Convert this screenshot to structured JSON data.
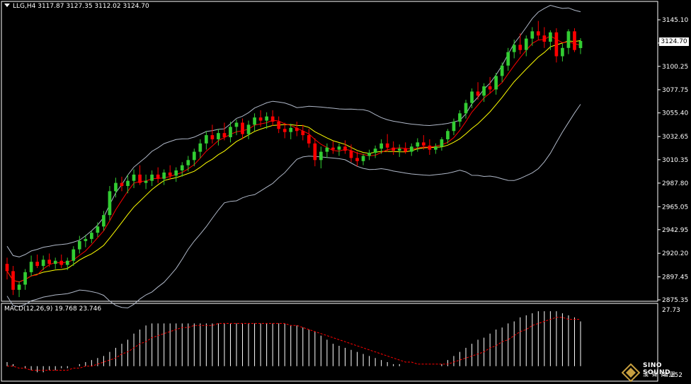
{
  "symbol_header": "LLG,H4",
  "ohlc": {
    "open": "3117.87",
    "high": "3127.35",
    "low": "3112.02",
    "close": "3124.70"
  },
  "current_price": "3124.70",
  "price_axis": [
    "3145.10",
    "3122.70",
    "3100.25",
    "3077.75",
    "3055.40",
    "3032.65",
    "3010.35",
    "2987.80",
    "2965.05",
    "2942.95",
    "2920.20",
    "2897.45",
    "2875.35"
  ],
  "macd": {
    "label": "MACD(12,26,9)",
    "main": "19.768",
    "signal": "23.746",
    "axis_max": "27.73",
    "axis_min": "-4.252"
  },
  "logo": {
    "name": "SINO SOUND",
    "sub": "漢 聲 商 圖"
  },
  "colors": {
    "bull": "#32cd32",
    "bear": "#ff0000",
    "bands": "#b0b8c8",
    "ma_fast": "#ff0000",
    "ma_slow": "#ffff00",
    "macd_bar": "#ffffff",
    "macd_signal": "#ff0000"
  },
  "chart_data": {
    "type": "candlestick",
    "panels": [
      "price",
      "macd"
    ],
    "price_range": [
      2875.35,
      3145.1
    ],
    "candles": [
      [
        2910,
        2916,
        2895,
        2903
      ],
      [
        2903,
        2908,
        2880,
        2885
      ],
      [
        2885,
        2893,
        2878,
        2890
      ],
      [
        2890,
        2905,
        2885,
        2902
      ],
      [
        2902,
        2918,
        2898,
        2912
      ],
      [
        2912,
        2919,
        2906,
        2908
      ],
      [
        2908,
        2918,
        2904,
        2914
      ],
      [
        2914,
        2920,
        2907,
        2910
      ],
      [
        2910,
        2916,
        2905,
        2913
      ],
      [
        2913,
        2919,
        2906,
        2909
      ],
      [
        2909,
        2916,
        2904,
        2913
      ],
      [
        2913,
        2927,
        2908,
        2924
      ],
      [
        2924,
        2937,
        2920,
        2932
      ],
      [
        2932,
        2938,
        2926,
        2934
      ],
      [
        2934,
        2942,
        2930,
        2940
      ],
      [
        2940,
        2950,
        2936,
        2946
      ],
      [
        2946,
        2961,
        2942,
        2957
      ],
      [
        2957,
        2985,
        2952,
        2980
      ],
      [
        2980,
        2993,
        2974,
        2988
      ],
      [
        2988,
        2994,
        2980,
        2985
      ],
      [
        2985,
        2996,
        2978,
        2990
      ],
      [
        2990,
        3001,
        2983,
        2996
      ],
      [
        2996,
        3005,
        2986,
        2988
      ],
      [
        2988,
        2996,
        2982,
        2990
      ],
      [
        2990,
        3000,
        2985,
        2996
      ],
      [
        2996,
        3003,
        2988,
        2992
      ],
      [
        2992,
        3001,
        2986,
        2998
      ],
      [
        2998,
        3005,
        2991,
        2995
      ],
      [
        2995,
        3003,
        2989,
        3000
      ],
      [
        3000,
        3008,
        2994,
        3005
      ],
      [
        3005,
        3014,
        2999,
        3010
      ],
      [
        3010,
        3021,
        3004,
        3018
      ],
      [
        3018,
        3030,
        3012,
        3026
      ],
      [
        3026,
        3038,
        3020,
        3034
      ],
      [
        3034,
        3044,
        3026,
        3030
      ],
      [
        3030,
        3040,
        3024,
        3036
      ],
      [
        3036,
        3046,
        3029,
        3032
      ],
      [
        3032,
        3047,
        3027,
        3042
      ],
      [
        3042,
        3049,
        3034,
        3046
      ],
      [
        3046,
        3050,
        3030,
        3035
      ],
      [
        3035,
        3048,
        3030,
        3044
      ],
      [
        3044,
        3055,
        3038,
        3051
      ],
      [
        3051,
        3058,
        3042,
        3048
      ],
      [
        3048,
        3056,
        3040,
        3052
      ],
      [
        3052,
        3058,
        3043,
        3047
      ],
      [
        3047,
        3052,
        3036,
        3040
      ],
      [
        3040,
        3046,
        3031,
        3037
      ],
      [
        3037,
        3045,
        3030,
        3041
      ],
      [
        3041,
        3047,
        3033,
        3038
      ],
      [
        3038,
        3044,
        3029,
        3034
      ],
      [
        3034,
        3040,
        3022,
        3026
      ],
      [
        3026,
        3031,
        3004,
        3010
      ],
      [
        3010,
        3023,
        3002,
        3018
      ],
      [
        3018,
        3026,
        3012,
        3022
      ],
      [
        3022,
        3028,
        3016,
        3020
      ],
      [
        3020,
        3026,
        3014,
        3023
      ],
      [
        3023,
        3029,
        3016,
        3019
      ],
      [
        3019,
        3025,
        3008,
        3012
      ],
      [
        3012,
        3018,
        3004,
        3009
      ],
      [
        3009,
        3016,
        3005,
        3014
      ],
      [
        3014,
        3020,
        3010,
        3017
      ],
      [
        3017,
        3024,
        3012,
        3021
      ],
      [
        3021,
        3030,
        3016,
        3026
      ],
      [
        3026,
        3035,
        3018,
        3022
      ],
      [
        3022,
        3028,
        3015,
        3019
      ],
      [
        3019,
        3025,
        3013,
        3021
      ],
      [
        3021,
        3027,
        3016,
        3018
      ],
      [
        3018,
        3026,
        3014,
        3023
      ],
      [
        3023,
        3031,
        3018,
        3027
      ],
      [
        3027,
        3034,
        3020,
        3024
      ],
      [
        3024,
        3030,
        3015,
        3020
      ],
      [
        3020,
        3026,
        3016,
        3023
      ],
      [
        3023,
        3032,
        3019,
        3030
      ],
      [
        3030,
        3040,
        3026,
        3038
      ],
      [
        3038,
        3050,
        3034,
        3047
      ],
      [
        3047,
        3058,
        3042,
        3055
      ],
      [
        3055,
        3068,
        3050,
        3065
      ],
      [
        3065,
        3079,
        3060,
        3076
      ],
      [
        3076,
        3085,
        3068,
        3072
      ],
      [
        3072,
        3084,
        3066,
        3081
      ],
      [
        3081,
        3090,
        3074,
        3078
      ],
      [
        3078,
        3094,
        3073,
        3091
      ],
      [
        3091,
        3104,
        3085,
        3101
      ],
      [
        3101,
        3118,
        3096,
        3114
      ],
      [
        3114,
        3126,
        3108,
        3121
      ],
      [
        3121,
        3132,
        3112,
        3116
      ],
      [
        3116,
        3130,
        3110,
        3127
      ],
      [
        3127,
        3138,
        3120,
        3134
      ],
      [
        3134,
        3144,
        3126,
        3130
      ],
      [
        3130,
        3138,
        3118,
        3124
      ],
      [
        3124,
        3135,
        3116,
        3133
      ],
      [
        3133,
        3137,
        3104,
        3110
      ],
      [
        3110,
        3122,
        3105,
        3118
      ],
      [
        3118,
        3136,
        3112,
        3134
      ],
      [
        3134,
        3137,
        3114,
        3116
      ],
      [
        3117.87,
        3127.35,
        3112.02,
        3124.7
      ]
    ],
    "macd_hist_range": [
      -4.252,
      27.73
    ],
    "macd_main": [
      2,
      1,
      0,
      -1,
      -2,
      -3,
      -3,
      -2,
      -2,
      -1,
      -1,
      0,
      1,
      2,
      3,
      4,
      5,
      7,
      9,
      11,
      13,
      16,
      18,
      20,
      21,
      21,
      21,
      21,
      21,
      21,
      21,
      21,
      21,
      21,
      21,
      21,
      21,
      21,
      21,
      21,
      21,
      21,
      21,
      21,
      21,
      21,
      21,
      20,
      20,
      19,
      18,
      17,
      15,
      13,
      11,
      10,
      9,
      8,
      7,
      6,
      5,
      4,
      3,
      2,
      1,
      1,
      0,
      0,
      0,
      0,
      0,
      0,
      1,
      3,
      5,
      7,
      9,
      11,
      13,
      14,
      16,
      18,
      19,
      21,
      22,
      24,
      25,
      26,
      27,
      27,
      27,
      27,
      26,
      25,
      24,
      22
    ],
    "macd_signal": [
      0,
      0,
      -1,
      -1,
      -2,
      -2,
      -2,
      -2,
      -2,
      -2,
      -2,
      -1,
      -1,
      0,
      0,
      1,
      2,
      3,
      4,
      6,
      7,
      9,
      11,
      12,
      14,
      15,
      16,
      17,
      18,
      19,
      19,
      20,
      20,
      20,
      20,
      21,
      21,
      21,
      21,
      21,
      21,
      21,
      21,
      21,
      21,
      21,
      21,
      20,
      20,
      19,
      18,
      17,
      16,
      15,
      14,
      13,
      12,
      11,
      10,
      9,
      8,
      7,
      6,
      5,
      4,
      3,
      2,
      2,
      1,
      1,
      1,
      1,
      1,
      1,
      2,
      3,
      4,
      5,
      6,
      7,
      9,
      10,
      12,
      13,
      15,
      17,
      18,
      20,
      21,
      22,
      23,
      24,
      24,
      23,
      23,
      23
    ],
    "title": "LLG,H4"
  }
}
